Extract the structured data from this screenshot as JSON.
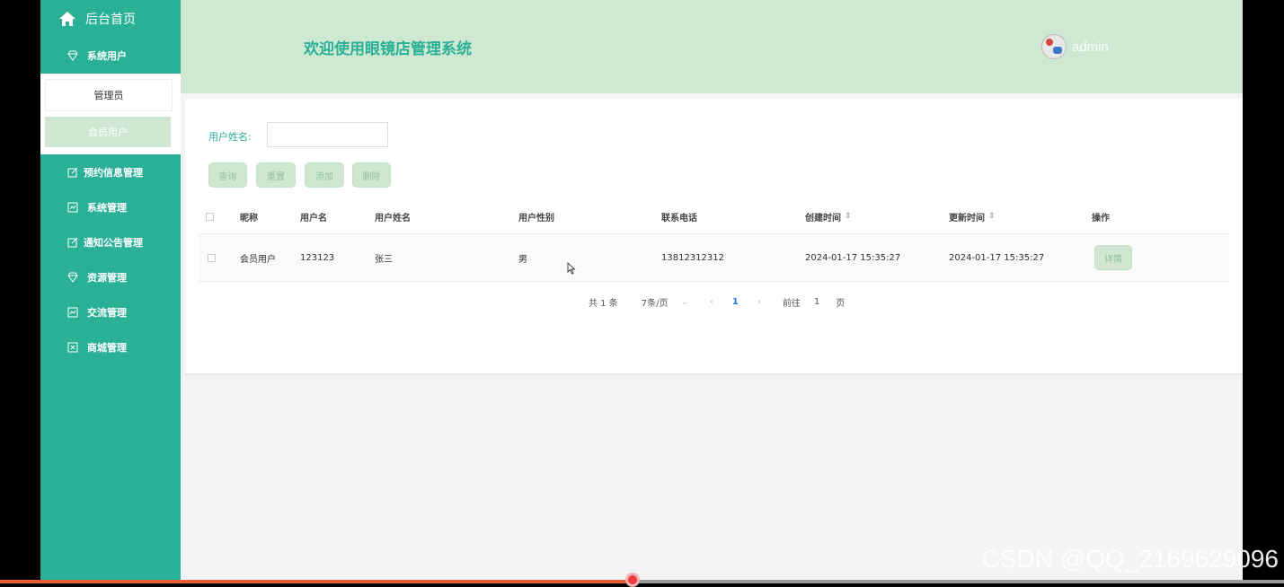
{
  "sidebar": {
    "home": "后台首页",
    "system_users": "系统用户",
    "sub_items": [
      "管理员",
      "会员用户"
    ],
    "items": [
      "预约信息管理",
      "系统管理",
      "通知公告管理",
      "资源管理",
      "交流管理",
      "商城管理"
    ]
  },
  "header": {
    "title": "欢迎使用眼镜店管理系统",
    "user": "admin"
  },
  "search": {
    "label": "用户姓名:",
    "placeholder": ""
  },
  "buttons": {
    "query": "查询",
    "reset": "重置",
    "add": "添加",
    "delete": "删除"
  },
  "table": {
    "headers": [
      "昵称",
      "用户名",
      "用户姓名",
      "用户性别",
      "联系电话",
      "创建时间",
      "更新时间",
      "操作"
    ],
    "rows": [
      {
        "nickname": "会员用户",
        "username": "123123",
        "realname": "张三",
        "gender": "男",
        "phone": "13812312312",
        "created": "2024-01-17 15:35:27",
        "updated": "2024-01-17 15:35:27",
        "action": "详情"
      }
    ]
  },
  "pager": {
    "total": "共 1 条",
    "size": "7条/页",
    "page": "1",
    "goto": "前往",
    "goto_page": "1",
    "unit": "页",
    "prev": "‹",
    "next": "›",
    "dropdown": "⌄"
  },
  "video": {
    "progress": 0.493
  },
  "watermark": "CSDN @QQ_2169629096",
  "colors": {
    "primary": "#2ab097",
    "header_bg": "#cfe8d2",
    "button_bg": "#cfe7d1",
    "progress": "#e85b39"
  }
}
